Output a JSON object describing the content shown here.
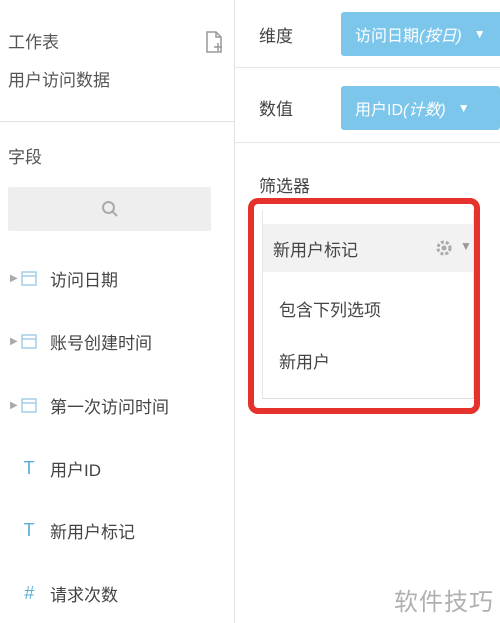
{
  "sidebar": {
    "worksheet_label": "工作表",
    "sheet_name": "用户访问数据",
    "fields_label": "字段",
    "fields": [
      {
        "type": "date",
        "label": "访问日期"
      },
      {
        "type": "date",
        "label": "账号创建时间"
      },
      {
        "type": "date",
        "label": "第一次访问时间"
      },
      {
        "type": "text",
        "glyph": "T",
        "label": "用户ID"
      },
      {
        "type": "text",
        "glyph": "T",
        "label": "新用户标记"
      },
      {
        "type": "number",
        "glyph": "#",
        "label": "请求次数"
      }
    ]
  },
  "config": {
    "dimension_label": "维度",
    "dimension_value": "访问日期",
    "dimension_mod": "(按日)",
    "measure_label": "数值",
    "measure_value": "用户ID",
    "measure_mod": "(计数)",
    "filter_label": "筛选器",
    "filter": {
      "title": "新用户标记",
      "condition": "包含下列选项",
      "value": "新用户"
    }
  },
  "watermark": "软件技巧",
  "colors": {
    "pill": "#7bc6ea",
    "highlight": "#e5322d",
    "type_icon": "#5aaed6"
  },
  "icons": {
    "doc": "document-icon",
    "search": "search-icon",
    "gear": "gear-icon",
    "calendar": "calendar-icon"
  }
}
